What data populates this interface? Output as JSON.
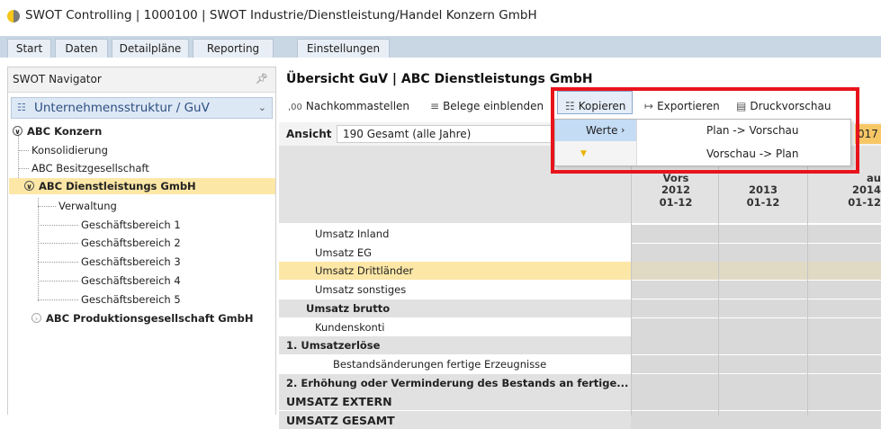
{
  "window": {
    "title": "SWOT Controlling | 1000100 | SWOT Industrie/Dienstleistung/Handel Konzern GmbH"
  },
  "tabs": [
    "Start",
    "Daten",
    "Detailpläne",
    "Reporting",
    "Einstellungen"
  ],
  "navigator": {
    "title": "SWOT Navigator",
    "dropdown": "Unternehmensstruktur / GuV",
    "tree": {
      "root": "ABC Konzern",
      "children": [
        "Konsolidierung",
        "ABC Besitzgesellschaft"
      ],
      "selected": "ABC Dienstleistungs GmbH",
      "sub": [
        "Verwaltung",
        "Geschäftsbereich 1",
        "Geschäftsbereich 2",
        "Geschäftsbereich 3",
        "Geschäftsbereich 4",
        "Geschäftsbereich 5"
      ],
      "other": "ABC Produktionsgesellschaft GmbH"
    }
  },
  "main": {
    "title": "Übersicht GuV | ABC Dienstleistungs GmbH",
    "toolbar": {
      "decimals": "Nachkommastellen",
      "decimals_icon": ",00",
      "vouchers": "Belege einblenden",
      "copy": "Kopieren",
      "export": "Exportieren",
      "print_preview": "Druckvorschau"
    },
    "ansicht": {
      "label": "Ansicht",
      "value": "190 Gesamt (alle Jahre)"
    },
    "column_headers": [
      {
        "top": "Vors",
        "year": "2012",
        "period": "01-12"
      },
      {
        "top": "",
        "year": "2013",
        "period": "01-12"
      },
      {
        "top": "au",
        "year": "2014",
        "period": "01-12"
      }
    ],
    "partial_year": "017",
    "rows": [
      {
        "label": "Umsatz Inland",
        "indent": 1,
        "bold": false,
        "highlight": false
      },
      {
        "label": "Umsatz EG",
        "indent": 1,
        "bold": false,
        "highlight": false
      },
      {
        "label": "Umsatz Drittländer",
        "indent": 1,
        "bold": false,
        "highlight": true
      },
      {
        "label": "Umsatz sonstiges",
        "indent": 1,
        "bold": false,
        "highlight": false
      },
      {
        "label": "Umsatz brutto",
        "indent": 0.5,
        "bold": true,
        "highlight": false
      },
      {
        "label": "Kundenskonti",
        "indent": 1,
        "bold": false,
        "highlight": false
      },
      {
        "label": "1. Umsatzerlöse",
        "indent": 0,
        "bold": true,
        "highlight": false
      },
      {
        "label": "Bestandsänderungen fertige Erzeugnisse",
        "indent": 1.5,
        "bold": false,
        "highlight": false
      },
      {
        "label": "2. Erhöhung oder Verminderung des Bestands an fertige...",
        "indent": 0,
        "bold": true,
        "highlight": false
      },
      {
        "label": "UMSATZ EXTERN",
        "indent": 0,
        "bold": true,
        "highlight": false
      },
      {
        "label": "UMSATZ GESAMT",
        "indent": 0,
        "bold": true,
        "highlight": false
      }
    ]
  },
  "context_menu": {
    "parent": "Werte",
    "options": [
      "Plan -> Vorschau",
      "Vorschau -> Plan"
    ]
  },
  "colors": {
    "highlight_row": "#fde7a6",
    "menu_selected": "#c5dcf5",
    "annotation_red": "#e8141c"
  }
}
